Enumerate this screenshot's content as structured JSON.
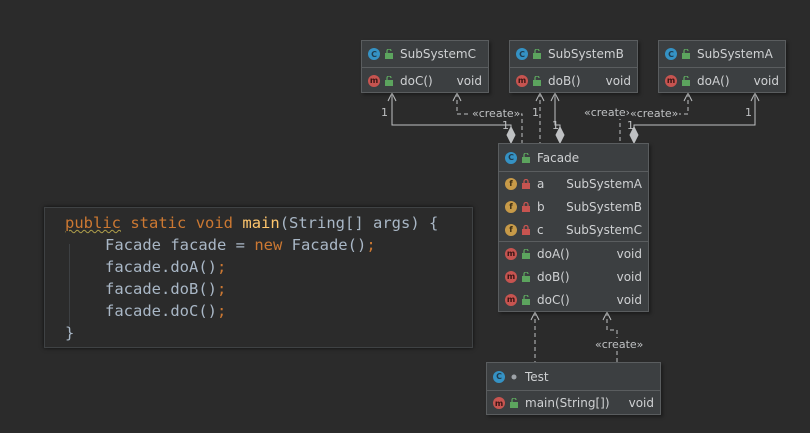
{
  "classes": {
    "subsystem_c": {
      "name": "SubSystemC",
      "methods": [
        {
          "name": "doC()",
          "type": "void"
        }
      ]
    },
    "subsystem_b": {
      "name": "SubSystemB",
      "methods": [
        {
          "name": "doB()",
          "type": "void"
        }
      ]
    },
    "subsystem_a": {
      "name": "SubSystemA",
      "methods": [
        {
          "name": "doA()",
          "type": "void"
        }
      ]
    },
    "facade": {
      "name": "Facade",
      "fields": [
        {
          "name": "a",
          "type": "SubSystemA"
        },
        {
          "name": "b",
          "type": "SubSystemB"
        },
        {
          "name": "c",
          "type": "SubSystemC"
        }
      ],
      "methods": [
        {
          "name": "doA()",
          "type": "void"
        },
        {
          "name": "doB()",
          "type": "void"
        },
        {
          "name": "doC()",
          "type": "void"
        }
      ]
    },
    "test": {
      "name": "Test",
      "methods": [
        {
          "name": "main(String[])",
          "type": "void"
        }
      ]
    }
  },
  "edge_labels": {
    "create": "«create»",
    "multiplicity": "1"
  },
  "icons": {
    "class_badge": "C",
    "method_badge": "m",
    "field_badge": "f"
  },
  "colors": {
    "background": "#2b2b2b",
    "keyword": "#cc7832",
    "method_name": "#ffc66d",
    "text": "#a9b7c6",
    "class_badge": "#3592c4",
    "method_badge": "#c75450",
    "field_badge": "#c79a48"
  },
  "code": {
    "kw_public": "public",
    "kw_static": "static",
    "kw_void": "void",
    "fn_main": "main",
    "main_params": "(String[] args) {",
    "l2_decl": "Facade facade = ",
    "kw_new": "new",
    "l2_ctor": " Facade()",
    "semicolon": ";",
    "call_a": "facade.doA()",
    "call_b": "facade.doB()",
    "call_c": "facade.doC()",
    "close_brace": "}"
  }
}
